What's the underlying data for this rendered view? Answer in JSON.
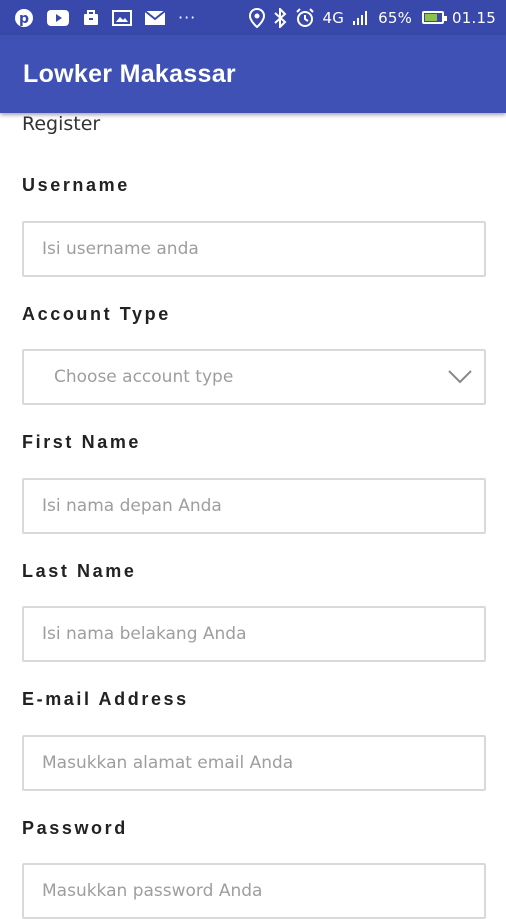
{
  "status_bar": {
    "icons": [
      "pinterest-icon",
      "youtube-icon",
      "briefcase-icon",
      "gallery-icon",
      "mail-icon",
      "more-dots-icon",
      "location-icon",
      "bluetooth-icon",
      "alarm-icon",
      "network-4g-icon",
      "signal-icon"
    ],
    "dots": "···",
    "network": "4G",
    "battery_percent": "65%",
    "battery_level": 0.65,
    "time": "01.15"
  },
  "appbar": {
    "title": "Lowker Makassar"
  },
  "form": {
    "section_title": "Register",
    "username": {
      "label": "Username",
      "placeholder": "Isi username anda"
    },
    "account_type": {
      "label": "Account Type",
      "placeholder": "Choose account type"
    },
    "first_name": {
      "label": "First Name",
      "placeholder": "Isi nama depan Anda"
    },
    "last_name": {
      "label": "Last Name",
      "placeholder": "Isi nama belakang Anda"
    },
    "email": {
      "label": "E-mail Address",
      "placeholder": "Masukkan alamat email Anda"
    },
    "password": {
      "label": "Password",
      "placeholder": "Masukkan password Anda"
    }
  },
  "colors": {
    "status_bar": "#3949ab",
    "app_bar": "#3f51b5",
    "field_border": "#d9d9d9",
    "placeholder": "#9e9e9e"
  }
}
